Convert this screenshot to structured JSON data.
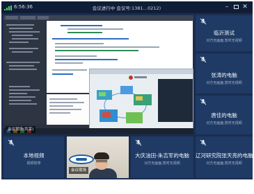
{
  "titlebar": {
    "time": "6:56:36",
    "meeting_title": "会议进行中 会议号:1381…0212)"
  },
  "share": {
    "presenter_tag": "会议现场(共享)",
    "status_colors": {
      "code_keyword": "#2d6cc0",
      "code_string": "#2e8b57",
      "code_plain": "#9aa4b2"
    }
  },
  "participants_right": [
    {
      "name": "临沂测试",
      "status": "对方无画面,暂时无视频",
      "mic_muted": true
    },
    {
      "name": "张涛的电脑",
      "status": "对方无画面,暂时无视频",
      "mic_muted": true
    },
    {
      "name": "唐佳的电脑",
      "status": "对方无画面,暂时无视频",
      "mic_muted": true
    }
  ],
  "participants_bottom": [
    {
      "name": "本地视频",
      "status": "视频暂停",
      "mic_muted": true
    },
    {
      "name": "会议现场",
      "camera": true,
      "mic_muted": false
    },
    {
      "name": "大庆油田-朱吉军的电脑",
      "status": "对方无画面,暂时无视频",
      "mic_muted": true
    },
    {
      "name": "辽河研究院张天亮的电脑",
      "status": "对方无画面,暂时无视频",
      "mic_muted": true
    }
  ],
  "colors": {
    "background": "#1a2d4f",
    "tile": "#1f3a64",
    "accent": "#4cd964"
  }
}
